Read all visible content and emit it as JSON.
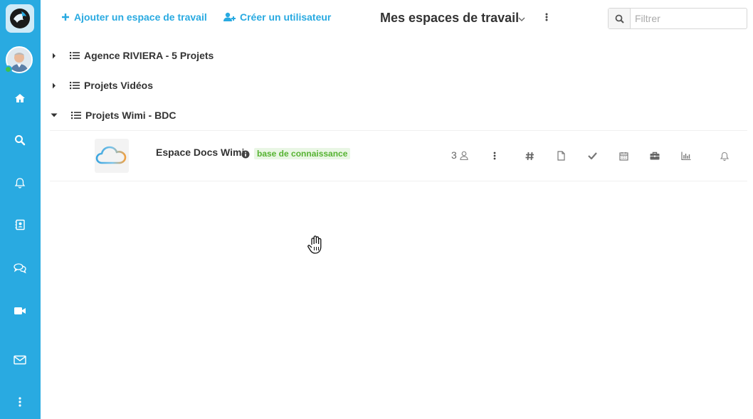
{
  "header": {
    "add_workspace_label": "Ajouter un espace de travail",
    "create_user_label": "Créer un utilisateur",
    "title": "Mes espaces de travail",
    "filter_placeholder": "Filtrer"
  },
  "groups": [
    {
      "label": "Agence RIVIERA - 5 Projets",
      "expanded": false
    },
    {
      "label": "Projets Vidéos",
      "expanded": false
    },
    {
      "label": "Projets Wimi - BDC",
      "expanded": true
    }
  ],
  "workspace": {
    "name": "Espace Docs Wimi",
    "tag": "base de connaissance",
    "member_count": "3"
  },
  "sidebar": {
    "items": [
      "home-icon",
      "search-icon",
      "bell-icon",
      "contacts-icon",
      "chat-icon",
      "video-icon",
      "mail-icon",
      "more-icon"
    ]
  },
  "colors": {
    "sidebar": "#29aae1",
    "accent": "#29aae1",
    "tag_bg": "#e9f6e4",
    "tag_text": "#55b331",
    "status_online": "#3ec14a"
  }
}
